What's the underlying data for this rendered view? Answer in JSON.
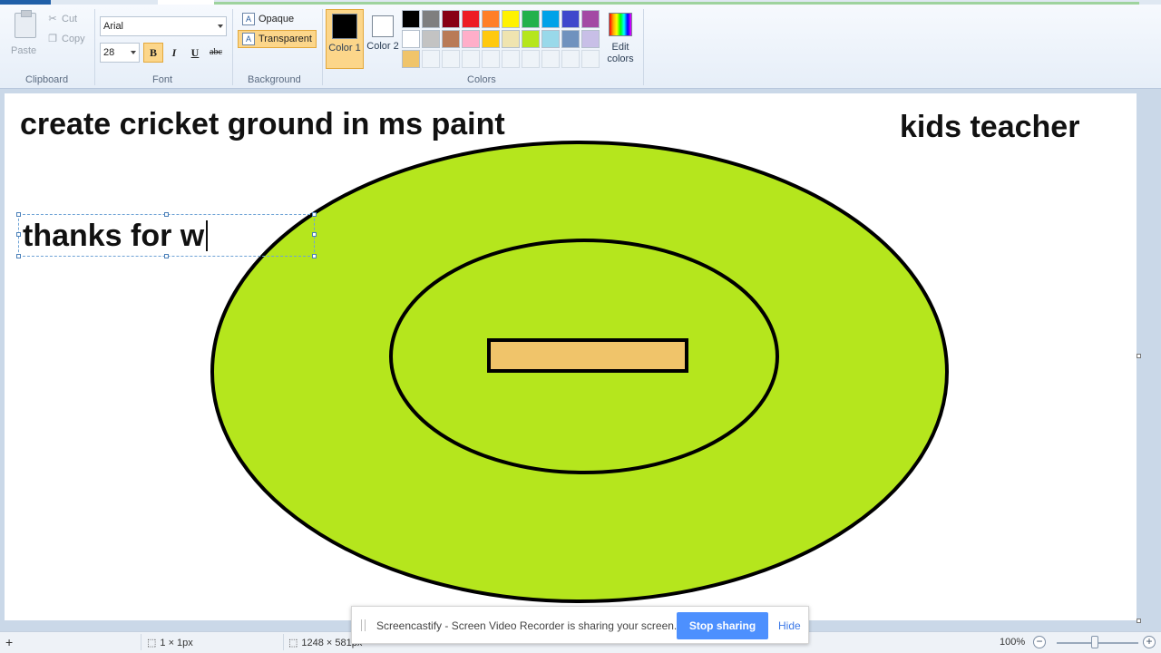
{
  "ribbon": {
    "clipboard": {
      "paste": "Paste",
      "cut": "Cut",
      "copy": "Copy",
      "group": "Clipboard"
    },
    "font": {
      "name": "Arial",
      "size": "28",
      "bold": "B",
      "italic": "I",
      "underline": "U",
      "strike": "abc",
      "group": "Font"
    },
    "background": {
      "opaque": "Opaque",
      "transparent": "Transparent",
      "group": "Background"
    },
    "colors": {
      "color1_label": "Color 1",
      "color2_label": "Color 2",
      "color1": "#000000",
      "color2": "#ffffff",
      "edit_colors": "Edit colors",
      "group": "Colors",
      "palette_row1": [
        "#000000",
        "#7f7f7f",
        "#880015",
        "#ed1c24",
        "#ff7f27",
        "#fff200",
        "#22b14c",
        "#00a2e8",
        "#3f48cc",
        "#a349a4"
      ],
      "palette_row2": [
        "#ffffff",
        "#c3c3c3",
        "#b97a57",
        "#ffaec9",
        "#ffc90e",
        "#efe4b0",
        "#b5e61d",
        "#99d9ea",
        "#7092be",
        "#c8bfe7"
      ],
      "palette_row3": [
        "#f0c46a"
      ]
    }
  },
  "canvas": {
    "title": "create cricket ground in ms paint",
    "author": "kids teacher",
    "textbox_text": "thanks for w",
    "field_color": "#b5e61d",
    "pitch_color": "#f0c46a",
    "outline_color": "#000000"
  },
  "status": {
    "selection_size": "1 × 1px",
    "canvas_size": "1248 × 581px",
    "zoom": "100%"
  },
  "share": {
    "message": "Screencastify - Screen Video Recorder is sharing your screen.",
    "stop": "Stop sharing",
    "hide": "Hide"
  }
}
